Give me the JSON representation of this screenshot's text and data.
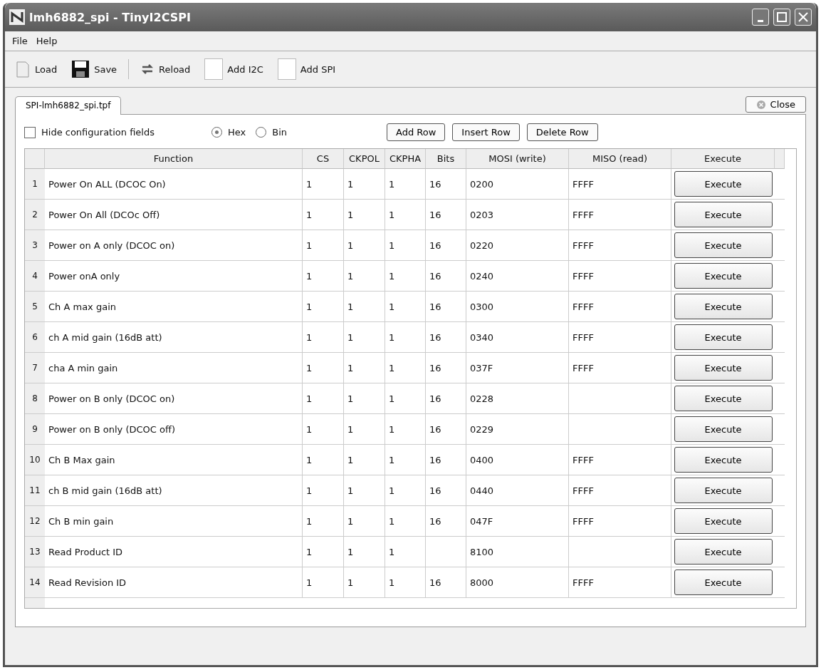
{
  "window": {
    "title": "lmh6882_spi - TinyI2CSPI"
  },
  "menu": [
    "File",
    "Help"
  ],
  "toolbar": [
    {
      "kind": "load",
      "label": "Load"
    },
    {
      "kind": "save",
      "label": "Save"
    },
    {
      "kind": "reload",
      "label": "Reload"
    },
    {
      "kind": "blank",
      "label": "Add I2C"
    },
    {
      "kind": "blank",
      "label": "Add SPI"
    }
  ],
  "tabs": [
    {
      "label": "SPI-lmh6882_spi.tpf",
      "selected": true
    }
  ],
  "close_button": "Close",
  "hide_config": {
    "label": "Hide configuration fields",
    "checked": false
  },
  "format": [
    {
      "label": "Hex",
      "selected": true
    },
    {
      "label": "Bin",
      "selected": false
    }
  ],
  "row_buttons": [
    "Add Row",
    "Insert Row",
    "Delete Row"
  ],
  "table": {
    "columns": [
      "Function",
      "CS",
      "CKPOL",
      "CKPHA",
      "Bits",
      "MOSI (write)",
      "MISO (read)",
      "Execute"
    ],
    "rows": [
      {
        "index": "1",
        "cells": [
          "Power On ALL (DCOC On)",
          "1",
          "1",
          "1",
          "16",
          "0200",
          "FFFF"
        ],
        "button": "Execute"
      },
      {
        "index": "2",
        "cells": [
          "Power On All (DCOc Off)",
          "1",
          "1",
          "1",
          "16",
          "0203",
          "FFFF"
        ],
        "button": "Execute"
      },
      {
        "index": "3",
        "cells": [
          "Power on A only (DCOC on)",
          "1",
          "1",
          "1",
          "16",
          "0220",
          "FFFF"
        ],
        "button": "Execute"
      },
      {
        "index": "4",
        "cells": [
          "Power onA only",
          "1",
          "1",
          "1",
          "16",
          "0240",
          "FFFF"
        ],
        "button": "Execute"
      },
      {
        "index": "5",
        "cells": [
          "Ch A max gain",
          "1",
          "1",
          "1",
          "16",
          "0300",
          "FFFF"
        ],
        "button": "Execute"
      },
      {
        "index": "6",
        "cells": [
          "ch A mid gain (16dB att)",
          "1",
          "1",
          "1",
          "16",
          "0340",
          "FFFF"
        ],
        "button": "Execute"
      },
      {
        "index": "7",
        "cells": [
          "cha A min gain",
          "1",
          "1",
          "1",
          "16",
          "037F",
          "FFFF"
        ],
        "button": "Execute"
      },
      {
        "index": "8",
        "cells": [
          "Power on B only (DCOC on)",
          "1",
          "1",
          "1",
          "16",
          "0228",
          ""
        ],
        "button": "Execute"
      },
      {
        "index": "9",
        "cells": [
          "Power on B only (DCOC off)",
          "1",
          "1",
          "1",
          "16",
          "0229",
          ""
        ],
        "button": "Execute"
      },
      {
        "index": "10",
        "cells": [
          "Ch B Max gain",
          "1",
          "1",
          "1",
          "16",
          "0400",
          "FFFF"
        ],
        "button": "Execute"
      },
      {
        "index": "11",
        "cells": [
          "ch B mid gain (16dB att)",
          "1",
          "1",
          "1",
          "16",
          "0440",
          "FFFF"
        ],
        "button": "Execute"
      },
      {
        "index": "12",
        "cells": [
          "Ch B min gain",
          "1",
          "1",
          "1",
          "16",
          "047F",
          "FFFF"
        ],
        "button": "Execute"
      },
      {
        "index": "13",
        "cells": [
          "Read Product ID",
          "1",
          "1",
          "1",
          "",
          "8100",
          ""
        ],
        "button": "Execute"
      },
      {
        "index": "14",
        "cells": [
          "Read Revision ID",
          "1",
          "1",
          "1",
          "16",
          "8000",
          "FFFF"
        ],
        "button": "Execute"
      }
    ]
  }
}
